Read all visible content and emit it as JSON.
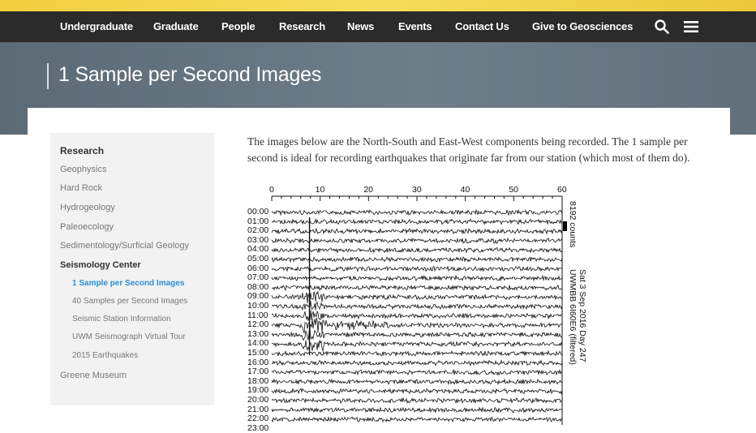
{
  "nav": {
    "items": [
      "Undergraduate",
      "Graduate",
      "People",
      "Research",
      "News",
      "Events",
      "Contact Us",
      "Give to Geosciences"
    ],
    "search_icon": "search-icon",
    "menu_icon": "hamburger-menu-icon"
  },
  "page": {
    "title": "1 Sample per Second Images"
  },
  "sidebar": {
    "heading": "Research",
    "items": [
      "Geophysics",
      "Hard Rock",
      "Hydrogeology",
      "Paleoecology",
      "Sedimentology/Surficial Geology"
    ],
    "section": "Seismology Center",
    "subitems": [
      "1 Sample per Second Images",
      "40 Samples per Second Images",
      "Seismic Station Information",
      "UWM Seismograph Virtual Tour",
      "2015 Earthquakes"
    ],
    "active_subitem": "1 Sample per Second Images",
    "last": "Greene Museum"
  },
  "content": {
    "intro": "The images below are the North-South and East-West components being recorded. The 1 sample per second is ideal for recording earthquakes that originate far from our station (which most of them do)."
  },
  "seismogram": {
    "x_ticks": [
      "0",
      "10",
      "20",
      "30",
      "40",
      "50",
      "60"
    ],
    "hours": [
      "00:00",
      "01:00",
      "02:00",
      "03:00",
      "04:00",
      "05:00",
      "06:00",
      "07:00",
      "08:00",
      "09:00",
      "10:00",
      "11:00",
      "12:00",
      "13:00",
      "14:00",
      "15:00",
      "16:00",
      "17:00",
      "18:00",
      "19:00",
      "20:00",
      "21:00",
      "22:00",
      "23:00"
    ],
    "scale_label": "8192 counts",
    "date_label": "Sat 3 Sep 2016  Day 247",
    "station_label": "UWMBB 6I60E6 (filtered)"
  },
  "colors": {
    "accent_gold": "#f1cf3f",
    "nav_bg": "#2b2b2b",
    "hero_bg": "#6e7e89",
    "link_active": "#2a8fd6"
  }
}
